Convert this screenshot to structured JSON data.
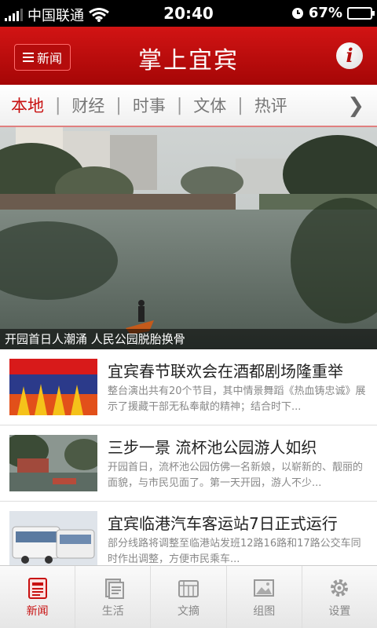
{
  "status_bar": {
    "carrier": "中国联通",
    "time": "20:40",
    "battery_percent": "67%",
    "battery_level": 0.67
  },
  "header": {
    "menu_label": "新闻",
    "title": "掌上宜宾",
    "info_icon": "i"
  },
  "tabs": [
    {
      "label": "本地"
    },
    {
      "label": "财经"
    },
    {
      "label": "时事"
    },
    {
      "label": "文体"
    },
    {
      "label": "热评"
    }
  ],
  "hero": {
    "caption": "开园首日人潮涌 人民公园脱胎换骨"
  },
  "news": [
    {
      "title": "宜宾春节联欢会在酒都剧场隆重举",
      "summary": "整台演出共有20个节目，其中情景舞蹈《热血铸忠诚》展示了援藏干部无私奉献的精神；结合时下..."
    },
    {
      "title": "三步一景 流杯池公园游人如织",
      "summary": "开园首日，流杯池公园仿佛一名新娘，以崭新的、靓丽的面貌，与市民见面了。第一天开园，游人不少..."
    },
    {
      "title": "宜宾临港汽车客运站7日正式运行",
      "summary": "部分线路将调整至临港站发班12路16路和17路公交车同时作出调整，方便市民乘车..."
    }
  ],
  "bottom_nav": [
    {
      "label": "新闻",
      "icon": "newspaper-icon"
    },
    {
      "label": "生活",
      "icon": "life-icon"
    },
    {
      "label": "文摘",
      "icon": "digest-icon"
    },
    {
      "label": "组图",
      "icon": "gallery-icon"
    },
    {
      "label": "设置",
      "icon": "gear-icon"
    }
  ],
  "colors": {
    "brand_red": "#c81010",
    "header_red": "#d21414"
  }
}
